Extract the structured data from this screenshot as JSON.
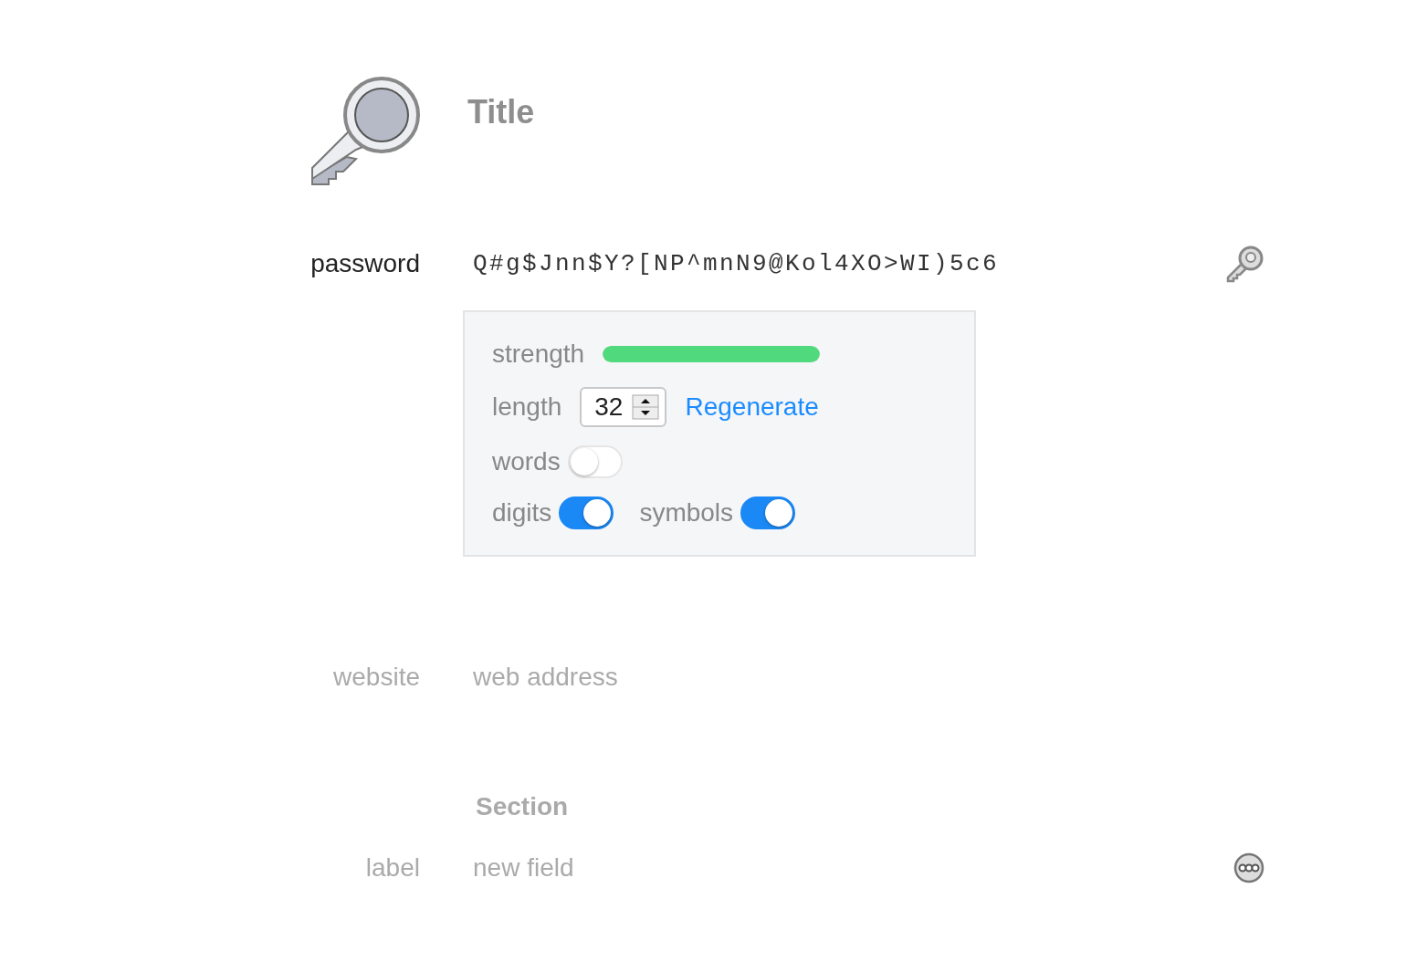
{
  "header": {
    "title": "Title"
  },
  "password": {
    "label": "password",
    "value": "Q#g$Jnn$Y?[NP^mnN9@Kol4XO>WI)5c6",
    "generator": {
      "strength_label": "strength",
      "level": 1,
      "length_label": "length",
      "length": "32",
      "regenerate": "Regenerate",
      "option_rows": [
        {
          "options": [
            {
              "label": "words",
              "on": false
            }
          ]
        },
        {
          "options": [
            {
              "label": "digits",
              "on": true
            },
            {
              "label": "symbols",
              "on": true
            }
          ]
        }
      ]
    }
  },
  "fields": [
    {
      "label": "website",
      "placeholder": "web address"
    }
  ],
  "section": {
    "title": "Section",
    "fields": [
      {
        "label": "label",
        "placeholder": "new field"
      }
    ]
  }
}
